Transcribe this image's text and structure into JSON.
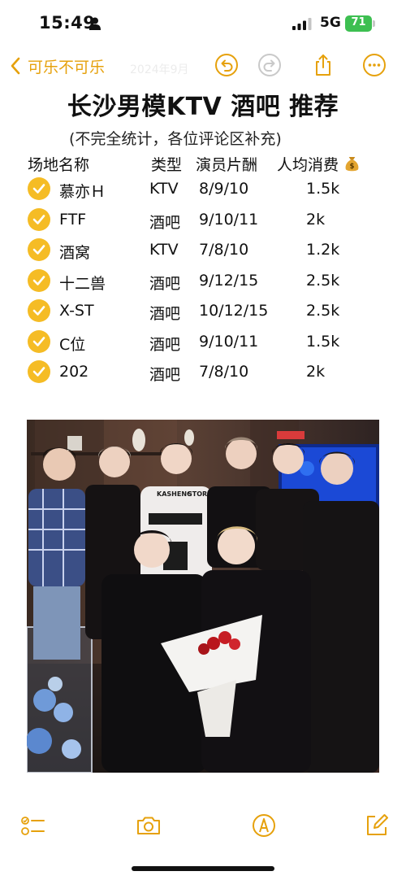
{
  "status_bar": {
    "time": "15:49",
    "network": "5G",
    "battery": "71"
  },
  "nav": {
    "back_label": "可乐不可乐",
    "date_faded": "2024年9月"
  },
  "note": {
    "title": "长沙男模KTV 酒吧 推荐",
    "subtitle": "(不完全统计，各位评论区补充)",
    "header": {
      "name": "场地名称",
      "type": "类型",
      "fee": "演员片酬",
      "spend": "人均消费"
    },
    "rows": [
      {
        "name": "慕亦Ｈ",
        "type": "KTV",
        "fee": "8/9/10",
        "spend": "1.5k",
        "checked": true
      },
      {
        "name": "FTF",
        "type": "酒吧",
        "fee": "9/10/11",
        "spend": "2k",
        "checked": true
      },
      {
        "name": "酒窝",
        "type": "KTV",
        "fee": "7/8/10",
        "spend": "1.2k",
        "checked": true
      },
      {
        "name": "十二兽",
        "type": "酒吧",
        "fee": "9/12/15",
        "spend": "2.5k",
        "checked": true
      },
      {
        "name": "X-ST",
        "type": "酒吧",
        "fee": "10/12/15",
        "spend": "2.5k",
        "checked": true
      },
      {
        "name": "C位",
        "type": "酒吧",
        "fee": "9/10/11",
        "spend": "1.5k",
        "checked": true
      },
      {
        "name": "202",
        "type": "酒吧",
        "fee": "7/8/10",
        "spend": "2k",
        "checked": true
      }
    ],
    "photo": {
      "jacket_text_1": "KASHENG",
      "jacket_text_2": "STORE"
    }
  },
  "icons": {
    "accent": "#e6a10c",
    "check_fill": "#f5bc25",
    "battery_color": "#3dbf51",
    "status_icons": [
      "person-icon",
      "signal-icon",
      "battery-icon"
    ],
    "toolbar": [
      "checklist-icon",
      "camera-icon",
      "markup-icon",
      "compose-icon"
    ],
    "header_emoji": "money-bag-icon"
  }
}
